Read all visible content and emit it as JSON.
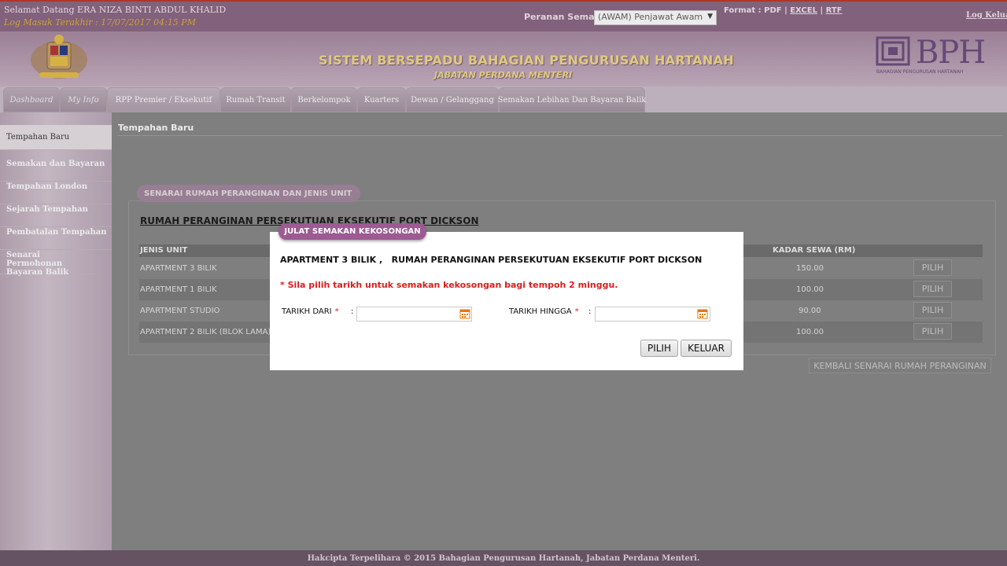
{
  "header": {
    "welcome": "Selamat Datang ERA NIZA BINTI ABDUL KHALID",
    "last_login": "Log Masuk Terakhir : 17/07/2017 04:15 PM",
    "role_label": "Peranan Semasa :",
    "role_value": "(AWAM) Penjawat Awam",
    "format_label": "Format : PDF |",
    "format_excel": "EXCEL",
    "format_sep": "|",
    "format_rtf": "RTF",
    "logout": "Log Keluar",
    "system_title": "SISTEM BERSEPADU BAHAGIAN PENGURUSAN HARTANAH",
    "system_subtitle": "JABATAN PERDANA MENTERI",
    "logo_text": "BPH",
    "logo_sub": "BAHAGIAN PENGURUSAN HARTANAH"
  },
  "tabs": [
    {
      "label": "Dashboard"
    },
    {
      "label": "My Info"
    },
    {
      "label": "RPP Premier / Eksekutif"
    },
    {
      "label": "Rumah Transit"
    },
    {
      "label": "Berkelompok"
    },
    {
      "label": "Kuarters"
    },
    {
      "label": "Dewan / Gelanggang"
    },
    {
      "label": "Semakan Lebihan Dan Bayaran Balik"
    }
  ],
  "sidebar": {
    "items": [
      {
        "label": "Tempahan Baru"
      },
      {
        "label": "Semakan dan Bayaran"
      },
      {
        "label": "Tempahan London"
      },
      {
        "label": "Sejarah Tempahan"
      },
      {
        "label": "Pembatalan Tempahan"
      },
      {
        "label": "Senarai Permohonan Bayaran Balik"
      }
    ]
  },
  "main": {
    "page_title": "Tempahan Baru",
    "panel_tag": "SENARAI RUMAH PERANGINAN DAN JENIS UNIT",
    "panel_heading": "RUMAH PERANGINAN PERSEKUTUAN EKSEKUTIF PORT DICKSON",
    "columns": {
      "unit": "JENIS UNIT",
      "rate": "KADAR SEWA (RM)"
    },
    "rows": [
      {
        "unit": "APARTMENT 3 BILIK",
        "rate": "150.00",
        "action": "PILIH"
      },
      {
        "unit": "APARTMENT 1 BILIK",
        "rate": "100.00",
        "action": "PILIH"
      },
      {
        "unit": "APARTMENT STUDIO",
        "rate": "90.00",
        "action": "PILIH"
      },
      {
        "unit": "APARTMENT 2 BILIK (BLOK LAMA)",
        "rate": "100.00",
        "action": "PILIH"
      }
    ],
    "back_button": "KEMBALI SENARAI RUMAH PERANGINAN"
  },
  "modal": {
    "tag": "JULAT SEMAKAN KEKOSONGAN",
    "title": "APARTMENT 3 BILIK ,   RUMAH PERANGINAN PERSEKUTUAN EKSEKUTIF PORT DICKSON",
    "note": "* Sila pilih tarikh untuk semakan kekosongan bagi tempoh 2 minggu.",
    "from_label": "TARIKH DARI",
    "to_label": "TARIKH HINGGA",
    "required_mark": "*",
    "colon": ":",
    "from_value": "",
    "to_value": "",
    "ok_button": "PILIH",
    "close_button": "KELUAR"
  },
  "footer": {
    "text": "Hakcipta Terpelihara © 2015 Bahagian Pengurusan Hartanah, Jabatan Perdana Menteri."
  },
  "colors": {
    "header": "#8d6a86",
    "accent": "#9d5a93",
    "required": "#d81f1f",
    "title_gold": "#f2dc8a"
  }
}
